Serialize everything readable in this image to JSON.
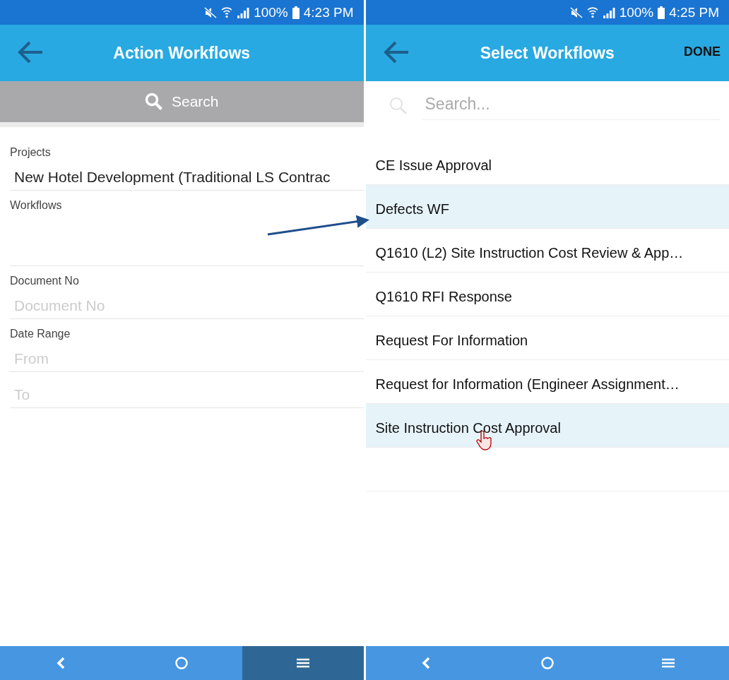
{
  "screens": [
    {
      "status_bar": {
        "battery": "100%",
        "time": "4:23 PM"
      },
      "header": {
        "title": "Action Workflows"
      },
      "search_bar": {
        "label": "Search"
      },
      "form": [
        {
          "label": "Projects",
          "value": "New Hotel Development (Traditional LS Contrac"
        },
        {
          "label": "Workflows"
        },
        {
          "label": "Document No",
          "placeholder": "Document No"
        },
        {
          "label": "Date Range",
          "placeholder": "From"
        },
        {
          "placeholder": "To"
        }
      ],
      "nav_bar": [
        {
          "kind": "back",
          "selected": false
        },
        {
          "kind": "home",
          "selected": false
        },
        {
          "kind": "menu",
          "selected": true
        }
      ]
    },
    {
      "status_bar": {
        "battery": "100%",
        "time": "4:25 PM"
      },
      "header": {
        "title": "Select Workflows",
        "action": "DONE"
      },
      "search_field": {
        "placeholder": "Search..."
      },
      "list": [
        {
          "label": "CE Issue Approval",
          "selected": false
        },
        {
          "label": "Defects WF",
          "selected": true
        },
        {
          "label": "Q1610 (L2) Site Instruction Cost Review & App…",
          "selected": false
        },
        {
          "label": "Q1610 RFI Response",
          "selected": false
        },
        {
          "label": "Request For Information",
          "selected": false
        },
        {
          "label": "Request for Information (Engineer Assignment…",
          "selected": false
        },
        {
          "label": "Site Instruction Cost Approval",
          "selected": true
        }
      ],
      "nav_bar": [
        {
          "kind": "back",
          "selected": false
        },
        {
          "kind": "home",
          "selected": false
        },
        {
          "kind": "menu",
          "selected": false
        }
      ]
    }
  ]
}
